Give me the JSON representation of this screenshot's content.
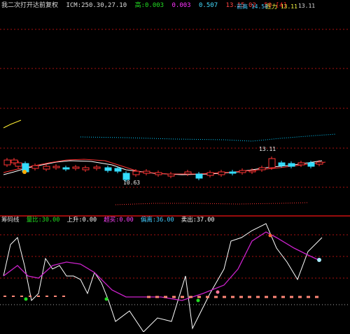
{
  "upper_header": {
    "title": "我二次打开达前复权",
    "values": [
      {
        "text": "ICM:250.30,27.10",
        "color": "#dddddd"
      },
      {
        "text": "高:0.003",
        "color": "#22dd22"
      },
      {
        "text": "0.003",
        "color": "#ff33ff"
      },
      {
        "text": "0.507",
        "color": "#44ddff"
      },
      {
        "text": "13.15 02",
        "color": "#ff4444"
      },
      {
        "text": "50 [4]",
        "color": "#ff2222"
      }
    ],
    "right_a": "前高 14.58",
    "right_b": "压力 13.11",
    "right_c": "13.11"
  },
  "lower_header": {
    "title": "筹码线",
    "items": [
      {
        "text": "量比:30.00",
        "color": "#22dd22"
      },
      {
        "text": "上升:0.00",
        "color": "#ffffff"
      },
      {
        "text": "超买:0.00",
        "color": "#ff44ff"
      },
      {
        "text": "偏离:36.00",
        "color": "#44ccff"
      },
      {
        "text": "卖出:37.00",
        "color": "#ffffff"
      }
    ]
  },
  "annotations": {
    "peak_label": "13.11",
    "low_label": "10.63"
  },
  "colors": {
    "up": "#ff3333",
    "down": "#33ddff",
    "grid": "#aa1111",
    "ma_white": "#ffffff",
    "ma_yellow": "#ffee33",
    "ma_red": "#ff3333",
    "dot_cyan": "#00ccff",
    "osc_white": "#ffffff",
    "osc_magenta": "#cc22cc",
    "salmon": "#ff8877"
  }
}
